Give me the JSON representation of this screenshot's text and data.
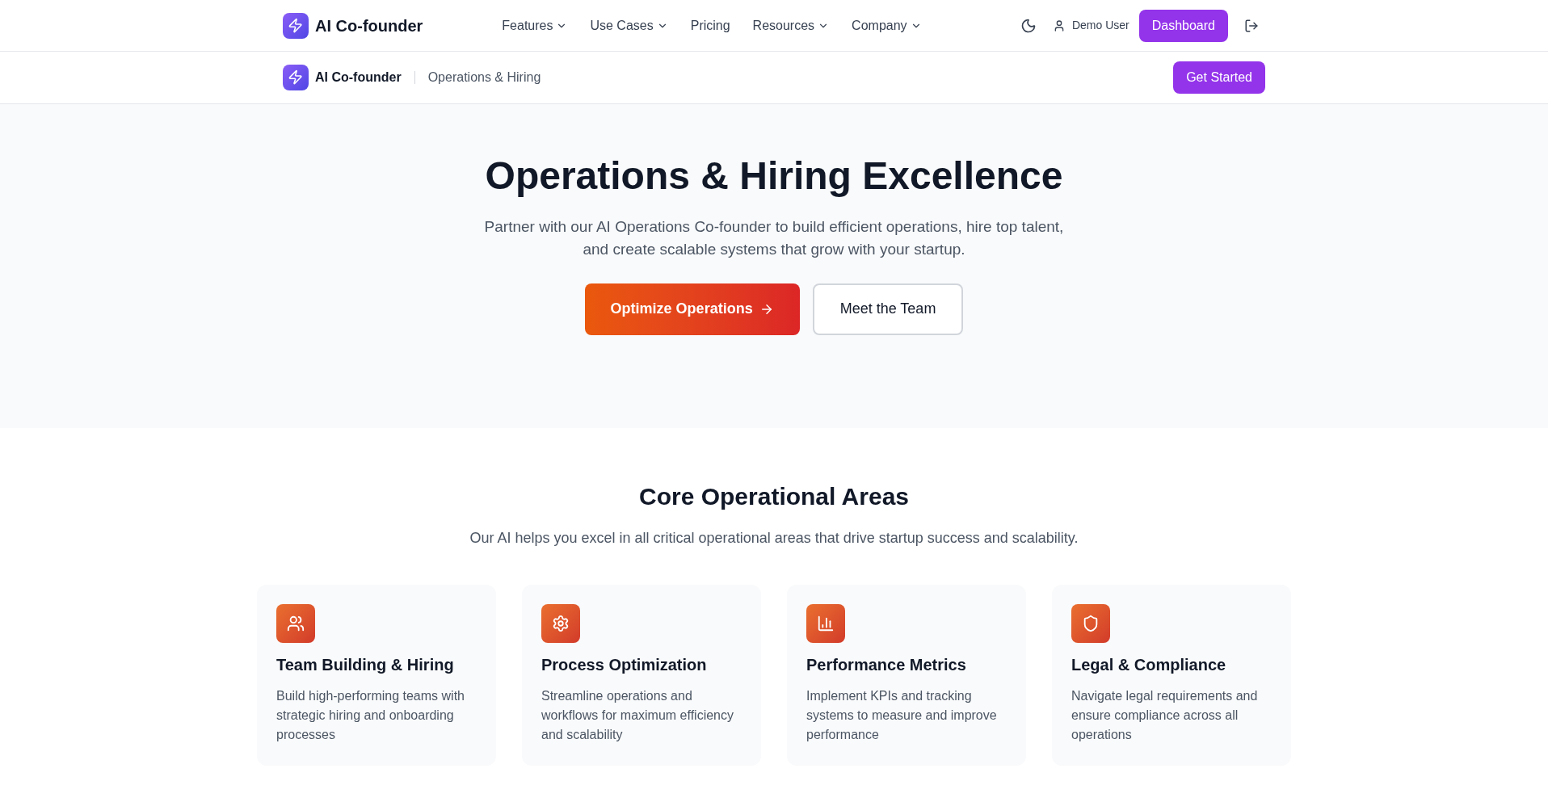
{
  "nav": {
    "logo": "AI Co-founder",
    "menu": [
      {
        "label": "Features",
        "dropdown": true
      },
      {
        "label": "Use Cases",
        "dropdown": true
      },
      {
        "label": "Pricing",
        "dropdown": false
      },
      {
        "label": "Resources",
        "dropdown": true
      },
      {
        "label": "Company",
        "dropdown": true
      }
    ],
    "user": "Demo User",
    "dashboard": "Dashboard"
  },
  "subbar": {
    "logo": "AI Co-founder",
    "page": "Operations & Hiring",
    "cta": "Get Started"
  },
  "hero": {
    "title": "Operations & Hiring Excellence",
    "lines": [
      "Partner with our AI Operations Co-founder to build efficient operations, hire top talent,",
      "and create scalable systems that grow with your startup."
    ],
    "primary": "Optimize Operations",
    "secondary": "Meet the Team"
  },
  "areas": {
    "title": "Core Operational Areas",
    "subtitle": "Our AI helps you excel in all critical operational areas that drive startup success and scalability.",
    "cards": [
      {
        "kind": "people",
        "title": "Team Building & Hiring",
        "text": "Build high-performing teams with strategic hiring and onboarding processes"
      },
      {
        "kind": "process",
        "title": "Process Optimization",
        "text": "Streamline operations and workflows for maximum efficiency and scalability"
      },
      {
        "kind": "metrics",
        "title": "Performance Metrics",
        "text": "Implement KPIs and tracking systems to measure and improve performance"
      },
      {
        "kind": "legal",
        "title": "Legal & Compliance",
        "text": "Navigate legal requirements and ensure compliance across all operations"
      }
    ]
  }
}
